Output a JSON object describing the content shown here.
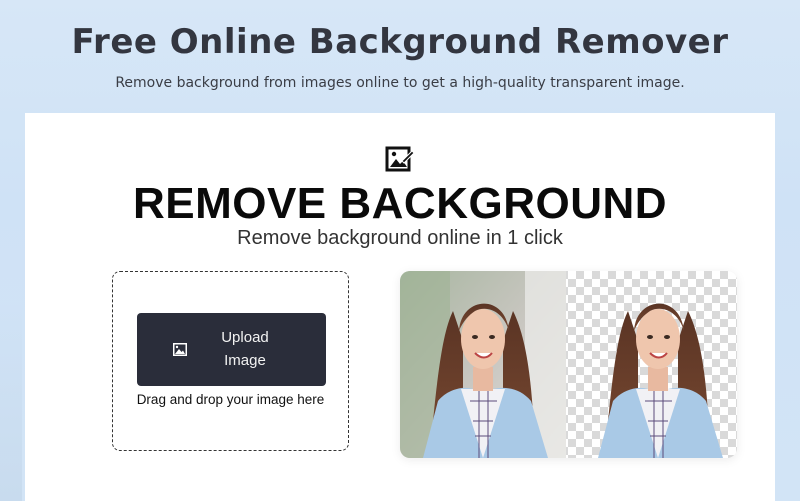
{
  "header": {
    "title": "Free Online Background Remover",
    "subtitle": "Remove background from images online to get a high-quality transparent image."
  },
  "tool": {
    "icon": "image-edit-icon",
    "title": "REMOVE BACKGROUND",
    "subtitle": "Remove background online in 1 click",
    "upload_button_label": "Upload Image",
    "upload_icon": "image-icon",
    "drop_hint": "Drag and drop your image here"
  },
  "preview": {
    "left_panel": "original photo",
    "right_panel": "transparent background"
  },
  "colors": {
    "page_bg": "#d2e4f6",
    "button_bg": "#2a2d3a",
    "title_text": "#333640"
  }
}
